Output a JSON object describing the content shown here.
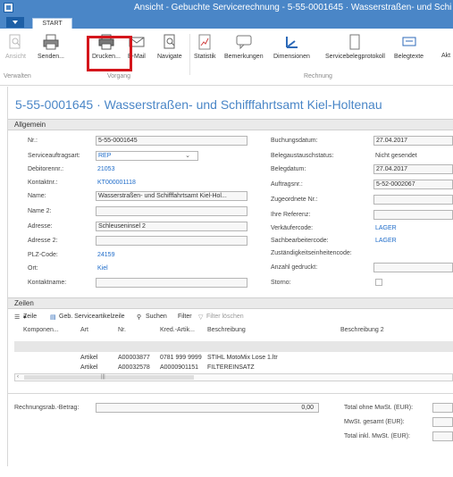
{
  "window": {
    "title": "Ansicht - Gebuchte Servicerechnung - 5-55-0001645 · Wasserstraßen- und Schi"
  },
  "tabs": {
    "start": "START"
  },
  "ribbon": {
    "buttons": {
      "ansicht": "Ansicht",
      "senden": "Senden...",
      "drucken": "Drucken...",
      "email": "E-Mail",
      "navigate": "Navigate",
      "statistik": "Statistik",
      "bemerkungen": "Bemerkungen",
      "dimensionen": "Dimensionen",
      "servicebelegprotokoll": "Servicebelegprotokoll",
      "belegtexte": "Belegtexte",
      "akt": "Akt"
    },
    "groups": {
      "verwalten": "Verwalten",
      "vorgang": "Vorgang",
      "rechnung": "Rechnung"
    }
  },
  "page": {
    "title": "5-55-0001645 · Wasserstraßen- und Schifffahrtsamt Kiel-Holtenau"
  },
  "allgemein": {
    "header": "Allgemein",
    "left": {
      "nr_label": "Nr.:",
      "nr_value": "5-55-0001645",
      "serviceauftragsart_label": "Serviceauftragsart:",
      "serviceauftragsart_value": "REP",
      "debitorennr_label": "Debitorennr.:",
      "debitorennr_value": "21053",
      "kontaktnr_label": "Kontaktnr.:",
      "kontaktnr_value": "KT000001118",
      "name_label": "Name:",
      "name_value": "Wasserstraßen- und Schifffahrtsamt Kiel-Hol...",
      "name2_label": "Name 2:",
      "name2_value": "",
      "adresse_label": "Adresse:",
      "adresse_value": "Schleuseninsel 2",
      "adresse2_label": "Adresse 2:",
      "adresse2_value": "",
      "plz_label": "PLZ-Code:",
      "plz_value": "24159",
      "ort_label": "Ort:",
      "ort_value": "Kiel",
      "kontaktname_label": "Kontaktname:",
      "kontaktname_value": ""
    },
    "right": {
      "buchungsdatum_label": "Buchungsdatum:",
      "buchungsdatum_value": "27.04.2017",
      "belegaustausch_label": "Belegaustauschstatus:",
      "belegaustausch_value": "Nicht gesendet",
      "belegdatum_label": "Belegdatum:",
      "belegdatum_value": "27.04.2017",
      "auftragsnr_label": "Auftragsnr.:",
      "auftragsnr_value": "5-52-0002067",
      "zugeordnete_label": "Zugeordnete Nr.:",
      "zugeordnete_value": "",
      "referenz_label": "Ihre Referenz:",
      "referenz_value": "",
      "verkaeufer_label": "Verkäufercode:",
      "verkaeufer_value": "LAGER",
      "sachbearbeiter_label": "Sachbearbeitercode:",
      "sachbearbeiter_value": "LAGER",
      "zustaendigkeit_label": "Zuständigkeitseinheitencode:",
      "zustaendigkeit_value": "",
      "anzahl_label": "Anzahl gedruckt:",
      "anzahl_value": "",
      "storno_label": "Storno:"
    }
  },
  "zeilen": {
    "header": "Zeilen",
    "toolbar": {
      "zeile": "Zeile",
      "geb_serviceartikelzeile": "Geb. Serviceartikelzeile",
      "suchen": "Suchen",
      "filter": "Filter",
      "filter_loeschen": "Filter löschen"
    },
    "columns": [
      "Komponen...",
      "Art",
      "Nr.",
      "Kred.-Artik...",
      "Beschreibung",
      "Beschreibung 2"
    ],
    "rows": [
      {
        "art": "Artikel",
        "nr": "A00003877",
        "kred": "0781 999 9999",
        "beschreibung": "STIHL MotoMix Lose 1.ltr"
      },
      {
        "art": "Artikel",
        "nr": "A00032578",
        "kred": "A0000901151",
        "beschreibung": "FILTEREINSATZ"
      }
    ]
  },
  "totals": {
    "rabatt_label": "Rechnungsrab.-Betrag:",
    "rabatt_value": "0,00",
    "ohne_mwst_label": "Total ohne MwSt. (EUR):",
    "mwst_label": "MwSt. gesamt (EUR):",
    "inkl_label": "Total inkl. MwSt. (EUR):"
  }
}
